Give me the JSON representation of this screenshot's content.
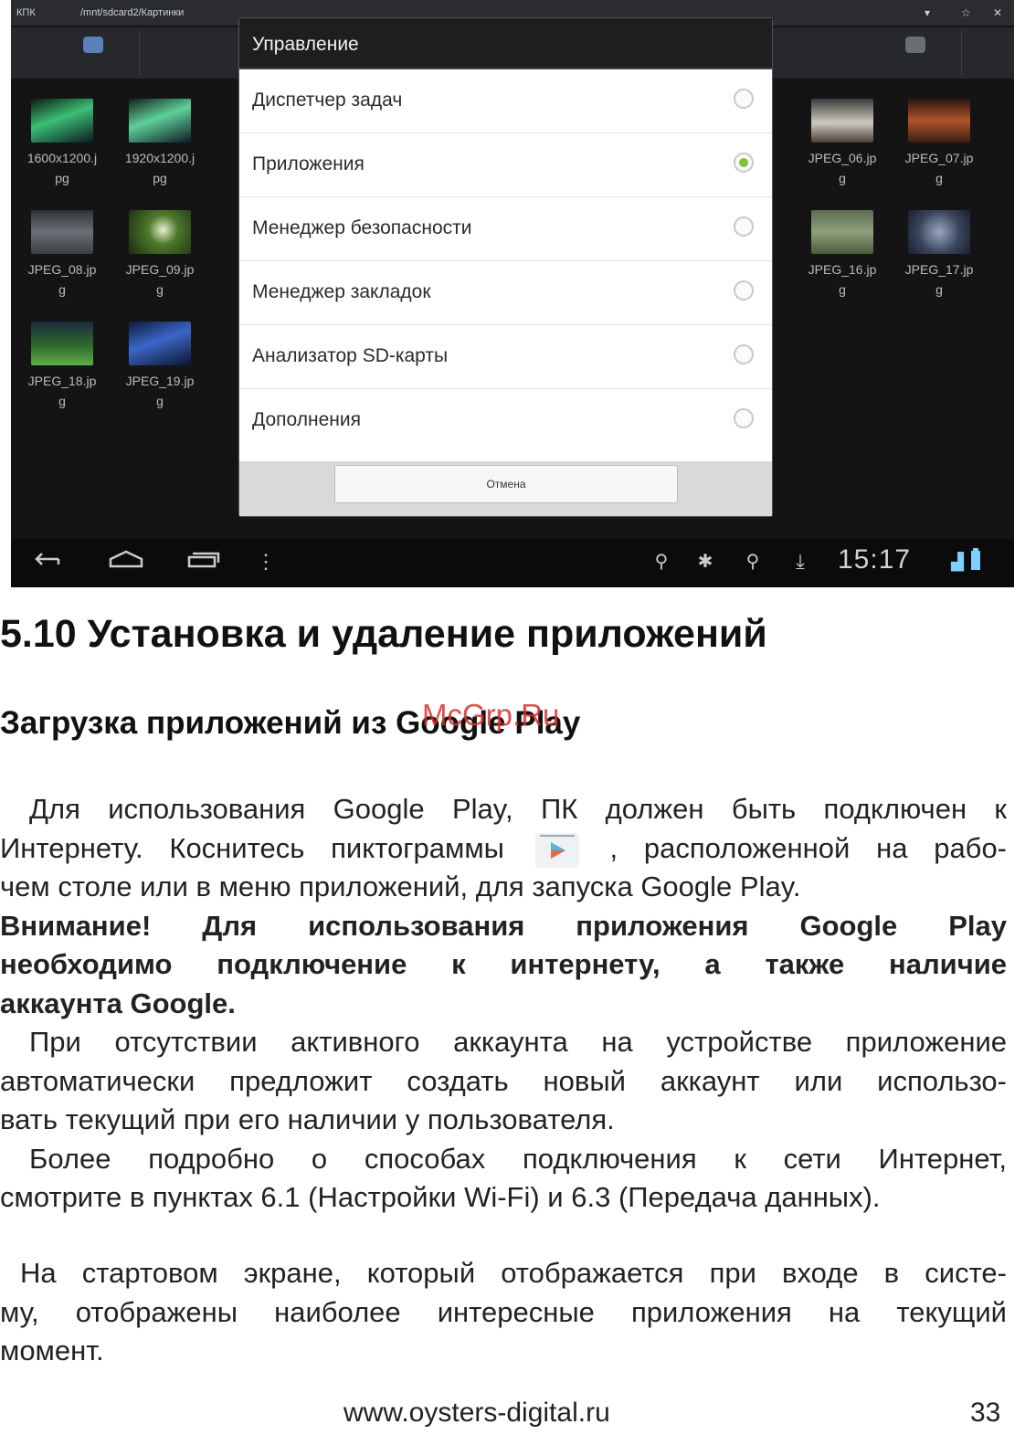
{
  "screenshot": {
    "topbar": {
      "app_label": "КПК",
      "path": "/mnt/sdcard2/Картинки"
    },
    "thumbnails": [
      {
        "name": "1600x1200.j\npg"
      },
      {
        "name": "1920x1200.j\npg"
      },
      {
        "name": "JPEG_06.jp\ng"
      },
      {
        "name": "JPEG_07.jp\ng"
      },
      {
        "name": "JPEG_08.jp\ng"
      },
      {
        "name": "JPEG_09.jp\ng"
      },
      {
        "name": "JPEG_16.jp\ng"
      },
      {
        "name": "JPEG_17.jp\ng"
      },
      {
        "name": "JPEG_18.jp\ng"
      },
      {
        "name": "JPEG_19.jp\ng"
      }
    ],
    "dialog": {
      "title": "Управление",
      "options": [
        {
          "label": "Диспетчер задач",
          "selected": false
        },
        {
          "label": "Приложения",
          "selected": true
        },
        {
          "label": "Менеджер безопасности",
          "selected": false
        },
        {
          "label": "Менеджер закладок",
          "selected": false
        },
        {
          "label": "Анализатор SD-карты",
          "selected": false
        },
        {
          "label": "Дополнения",
          "selected": false
        }
      ],
      "cancel_label": "Отмена"
    },
    "status": {
      "time": "15:17"
    }
  },
  "document": {
    "heading": "5.10 Установка и удаление приложений",
    "subheading": "Загрузка приложений из Google Play",
    "watermark": "McGrp.Ru",
    "p1": {
      "l1": "Для использования Google Play, ПК должен быть подключен к",
      "l2a": "Интернету. Коснитесь пиктограммы",
      "l2b": ", расположенной на рабо-",
      "l3": "чем столе или в меню приложений, для запуска Google Play."
    },
    "warning": {
      "l1": "Внимание! Для использования приложения Google Play",
      "l2": "необходимо подключение к интернету, а также наличие",
      "l3": "аккаунта Google."
    },
    "p2": {
      "l1": "При отсутствии активного аккаунта на устройстве приложение",
      "l2": "автоматически предложит создать новый аккаунт или использо-",
      "l3": "вать текущий при его наличии у пользователя."
    },
    "p3": {
      "l1": "Более подробно о способах подключения к сети Интернет,",
      "l2": "смотрите в пунктах 6.1 (Настройки Wi-Fi) и 6.3 (Передача данных)."
    },
    "p4": {
      "l1": "На стартовом экране, который отображается при входе в систе-",
      "l2": "му, отображены наиболее интересные приложения на текущий",
      "l3": "момент."
    },
    "footer_url": "www.oysters-digital.ru",
    "page_number": "33"
  }
}
